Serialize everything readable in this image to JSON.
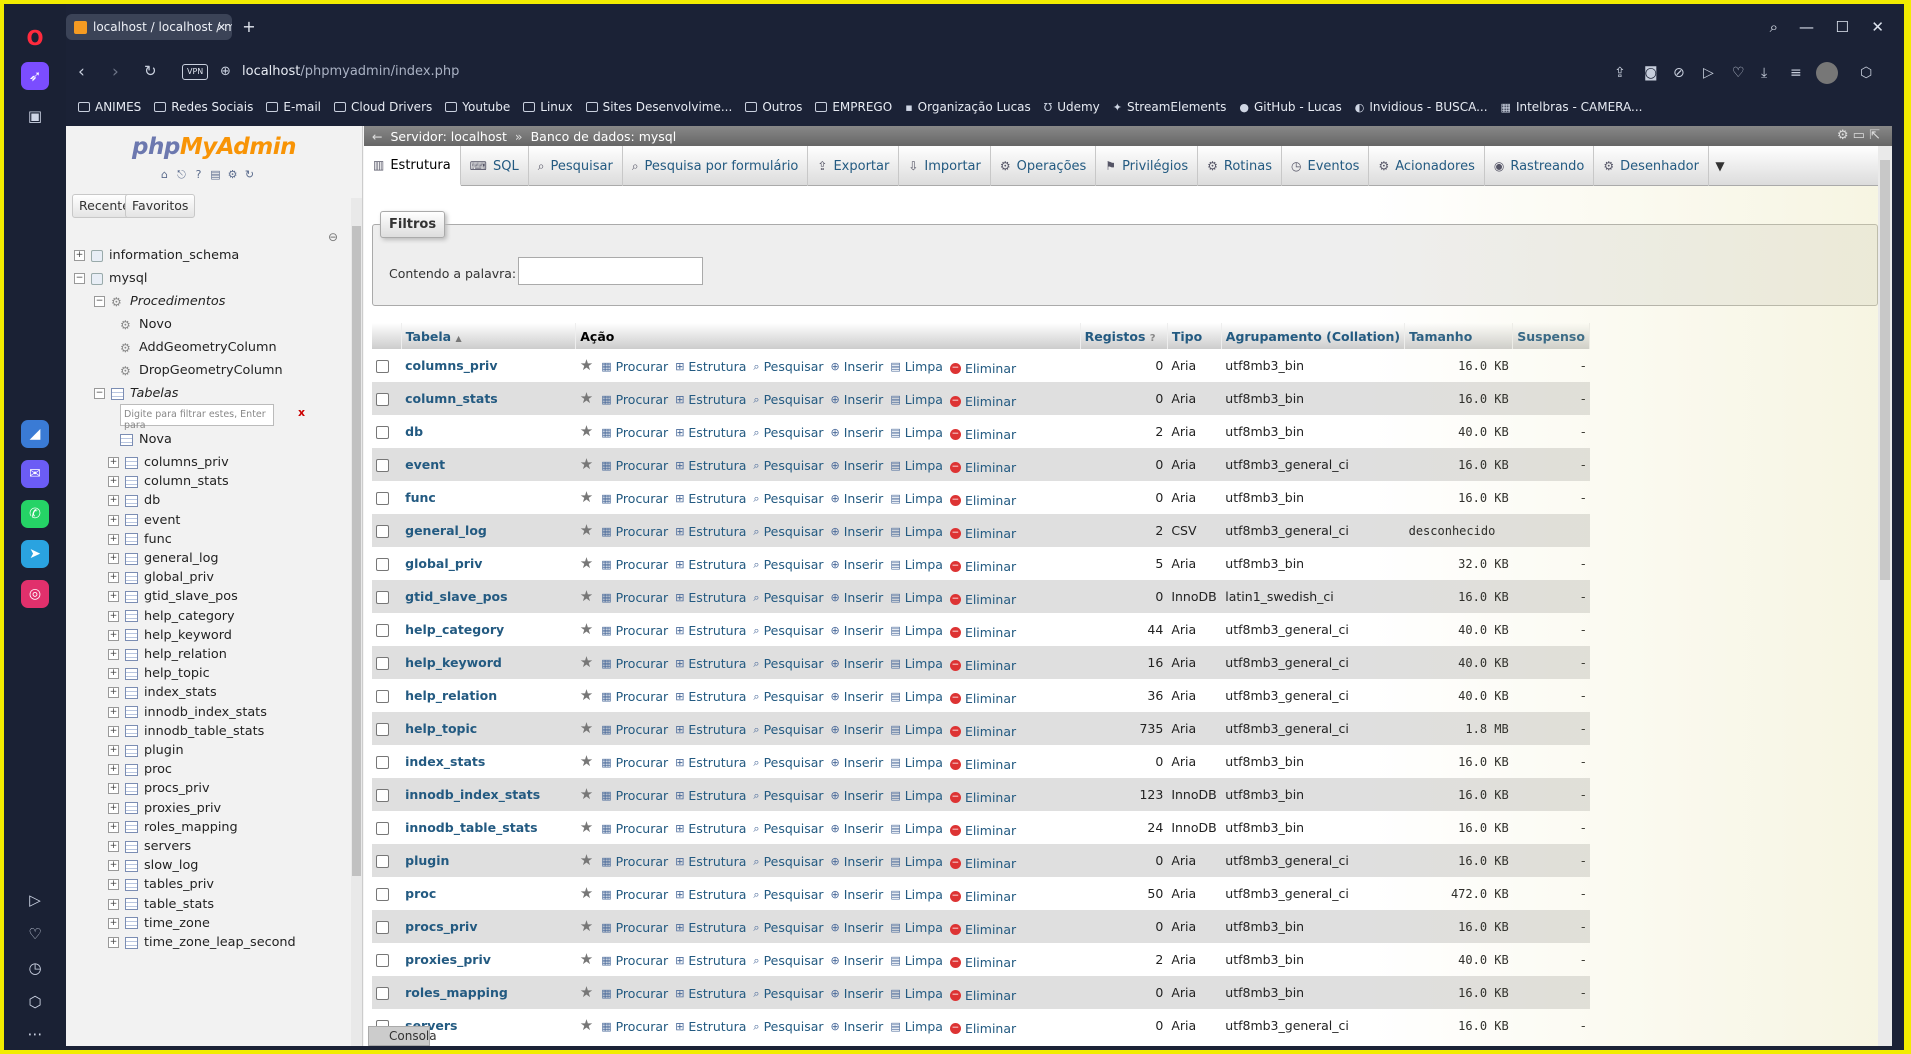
{
  "browser": {
    "tab_title": "localhost / localhost / my",
    "url_host": "localhost",
    "url_path": "/phpmyadmin/index.php",
    "vpn_label": "VPN",
    "bookmarks": [
      "ANIMES",
      "Redes Sociais",
      "E-mail",
      "Cloud Drivers",
      "Youtube",
      "Linux",
      "Sites Desenvolvime...",
      "Outros",
      "EMPREGO",
      "Organização Lucas",
      "Udemy",
      "StreamElements",
      "GitHub - Lucas",
      "Invidious - BUSCA...",
      "Intelbras - CAMERA..."
    ]
  },
  "left": {
    "logo_a": "php",
    "logo_b": "MyAdmin",
    "tab_recent": "Recente",
    "tab_favorites": "Favoritos",
    "db_information_schema": "information_schema",
    "db_mysql": "mysql",
    "procedures": "Procedimentos",
    "proc_new": "Novo",
    "proc_1": "AddGeometryColumn",
    "proc_2": "DropGeometryColumn",
    "tables": "Tabelas",
    "filter_placeholder": "Digite para filtrar estes, Enter para",
    "filter_clear": "x",
    "table_new": "Nova",
    "table_list": [
      "columns_priv",
      "column_stats",
      "db",
      "event",
      "func",
      "general_log",
      "global_priv",
      "gtid_slave_pos",
      "help_category",
      "help_keyword",
      "help_relation",
      "help_topic",
      "index_stats",
      "innodb_index_stats",
      "innodb_table_stats",
      "plugin",
      "proc",
      "procs_priv",
      "proxies_priv",
      "roles_mapping",
      "servers",
      "slow_log",
      "tables_priv",
      "table_stats",
      "time_zone",
      "time_zone_leap_second"
    ]
  },
  "breadcrumb": {
    "server": "Servidor: localhost",
    "sep": "»",
    "database": "Banco de dados: mysql"
  },
  "menu": [
    "Estrutura",
    "SQL",
    "Pesquisar",
    "Pesquisa por formulário",
    "Exportar",
    "Importar",
    "Operações",
    "Privilégios",
    "Rotinas",
    "Eventos",
    "Acionadores",
    "Rastreando",
    "Desenhador"
  ],
  "filters": {
    "legend": "Filtros",
    "label": "Contendo a palavra:"
  },
  "table": {
    "headers": {
      "name": "Tabela",
      "action": "Ação",
      "records": "Registos",
      "type": "Tipo",
      "collation": "Agrupamento (Collation)",
      "size": "Tamanho",
      "overhead": "Suspenso"
    },
    "actions": [
      "Procurar",
      "Estrutura",
      "Pesquisar",
      "Inserir",
      "Limpa",
      "Eliminar"
    ],
    "rows": [
      {
        "name": "columns_priv",
        "records": "0",
        "type": "Aria",
        "collation": "utf8mb3_bin",
        "size": "16.0 KB",
        "overhead": "-"
      },
      {
        "name": "column_stats",
        "records": "0",
        "type": "Aria",
        "collation": "utf8mb3_bin",
        "size": "16.0 KB",
        "overhead": "-"
      },
      {
        "name": "db",
        "records": "2",
        "type": "Aria",
        "collation": "utf8mb3_bin",
        "size": "40.0 KB",
        "overhead": "-"
      },
      {
        "name": "event",
        "records": "0",
        "type": "Aria",
        "collation": "utf8mb3_general_ci",
        "size": "16.0 KB",
        "overhead": "-"
      },
      {
        "name": "func",
        "records": "0",
        "type": "Aria",
        "collation": "utf8mb3_bin",
        "size": "16.0 KB",
        "overhead": "-"
      },
      {
        "name": "general_log",
        "records": "2",
        "type": "CSV",
        "collation": "utf8mb3_general_ci",
        "size": "desconhecido",
        "overhead": ""
      },
      {
        "name": "global_priv",
        "records": "5",
        "type": "Aria",
        "collation": "utf8mb3_bin",
        "size": "32.0 KB",
        "overhead": "-"
      },
      {
        "name": "gtid_slave_pos",
        "records": "0",
        "type": "InnoDB",
        "collation": "latin1_swedish_ci",
        "size": "16.0 KB",
        "overhead": "-"
      },
      {
        "name": "help_category",
        "records": "44",
        "type": "Aria",
        "collation": "utf8mb3_general_ci",
        "size": "40.0 KB",
        "overhead": "-"
      },
      {
        "name": "help_keyword",
        "records": "16",
        "type": "Aria",
        "collation": "utf8mb3_general_ci",
        "size": "40.0 KB",
        "overhead": "-"
      },
      {
        "name": "help_relation",
        "records": "36",
        "type": "Aria",
        "collation": "utf8mb3_general_ci",
        "size": "40.0 KB",
        "overhead": "-"
      },
      {
        "name": "help_topic",
        "records": "735",
        "type": "Aria",
        "collation": "utf8mb3_general_ci",
        "size": "1.8 MB",
        "overhead": "-"
      },
      {
        "name": "index_stats",
        "records": "0",
        "type": "Aria",
        "collation": "utf8mb3_bin",
        "size": "16.0 KB",
        "overhead": "-"
      },
      {
        "name": "innodb_index_stats",
        "records": "123",
        "type": "InnoDB",
        "collation": "utf8mb3_bin",
        "size": "16.0 KB",
        "overhead": "-"
      },
      {
        "name": "innodb_table_stats",
        "records": "24",
        "type": "InnoDB",
        "collation": "utf8mb3_bin",
        "size": "16.0 KB",
        "overhead": "-"
      },
      {
        "name": "plugin",
        "records": "0",
        "type": "Aria",
        "collation": "utf8mb3_general_ci",
        "size": "16.0 KB",
        "overhead": "-"
      },
      {
        "name": "proc",
        "records": "50",
        "type": "Aria",
        "collation": "utf8mb3_general_ci",
        "size": "472.0 KB",
        "overhead": "-"
      },
      {
        "name": "procs_priv",
        "records": "0",
        "type": "Aria",
        "collation": "utf8mb3_bin",
        "size": "16.0 KB",
        "overhead": "-"
      },
      {
        "name": "proxies_priv",
        "records": "2",
        "type": "Aria",
        "collation": "utf8mb3_bin",
        "size": "40.0 KB",
        "overhead": "-"
      },
      {
        "name": "roles_mapping",
        "records": "0",
        "type": "Aria",
        "collation": "utf8mb3_bin",
        "size": "16.0 KB",
        "overhead": "-"
      },
      {
        "name": "servers",
        "records": "0",
        "type": "Aria",
        "collation": "utf8mb3_general_ci",
        "size": "16.0 KB",
        "overhead": "-"
      }
    ]
  },
  "console": "Consola",
  "colors": {
    "link": "#235a81",
    "accent_orange": "#f89406",
    "browser_dark": "#1b2236",
    "frame_yellow": "#f2ec00"
  }
}
